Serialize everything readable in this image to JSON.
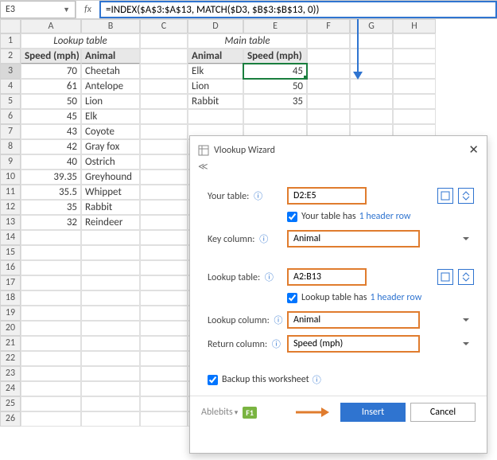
{
  "formula_bar": {
    "cell_ref": "E3",
    "formula": "=INDEX($A$3:$A$13, MATCH($D3, $B$3:$B$13, 0))"
  },
  "columns": [
    "A",
    "B",
    "C",
    "D",
    "E",
    "F",
    "G",
    "H"
  ],
  "rows": [
    "1",
    "2",
    "3",
    "4",
    "5",
    "6",
    "7",
    "8",
    "9",
    "10",
    "11",
    "12",
    "13",
    "14",
    "15",
    "16",
    "17",
    "18",
    "19",
    "20",
    "21",
    "22",
    "23",
    "24",
    "25",
    "26"
  ],
  "sheet": {
    "lookup_title": "Lookup table",
    "main_title": "Main table",
    "hdr_speed": "Speed (mph)",
    "hdr_animal": "Animal",
    "hdr_animal2": "Animal",
    "hdr_speed2": "Speed (mph)",
    "lookup": [
      {
        "speed": "70",
        "animal": "Cheetah"
      },
      {
        "speed": "61",
        "animal": "Antelope"
      },
      {
        "speed": "50",
        "animal": "Lion"
      },
      {
        "speed": "45",
        "animal": "Elk"
      },
      {
        "speed": "43",
        "animal": "Coyote"
      },
      {
        "speed": "42",
        "animal": "Gray fox"
      },
      {
        "speed": "40",
        "animal": "Ostrich"
      },
      {
        "speed": "39.35",
        "animal": "Greyhound"
      },
      {
        "speed": "35.5",
        "animal": "Whippet"
      },
      {
        "speed": "35",
        "animal": "Rabbit"
      },
      {
        "speed": "32",
        "animal": "Reindeer"
      }
    ],
    "main": [
      {
        "animal": "Elk",
        "speed": "45"
      },
      {
        "animal": "Lion",
        "speed": "50"
      },
      {
        "animal": "Rabbit",
        "speed": "35"
      }
    ]
  },
  "dialog": {
    "title": "Vlookup Wizard",
    "your_table_lbl": "Your table:",
    "your_table_val": "D2:E5",
    "your_table_chk": "Your table has",
    "header_link": "1 header row",
    "key_col_lbl": "Key column:",
    "key_col_val": "Animal",
    "lookup_table_lbl": "Lookup table:",
    "lookup_table_val": "A2:B13",
    "lookup_table_chk": "Lookup table has",
    "lookup_col_lbl": "Lookup column:",
    "lookup_col_val": "Animal",
    "return_col_lbl": "Return column:",
    "return_col_val": "Speed (mph)",
    "backup_chk": "Backup this worksheet",
    "brand": "Ablebits",
    "f1": "F1",
    "insert_btn": "Insert",
    "cancel_btn": "Cancel"
  },
  "chart_data": {
    "type": "table",
    "title": "Lookup table",
    "categories": [
      "Speed (mph)",
      "Animal"
    ],
    "series": [
      {
        "name": "Speed (mph)",
        "values": [
          70,
          61,
          50,
          45,
          43,
          42,
          40,
          39.35,
          35.5,
          35,
          32
        ]
      },
      {
        "name": "Animal",
        "values": [
          "Cheetah",
          "Antelope",
          "Lion",
          "Elk",
          "Coyote",
          "Gray fox",
          "Ostrich",
          "Greyhound",
          "Whippet",
          "Rabbit",
          "Reindeer"
        ]
      }
    ]
  }
}
